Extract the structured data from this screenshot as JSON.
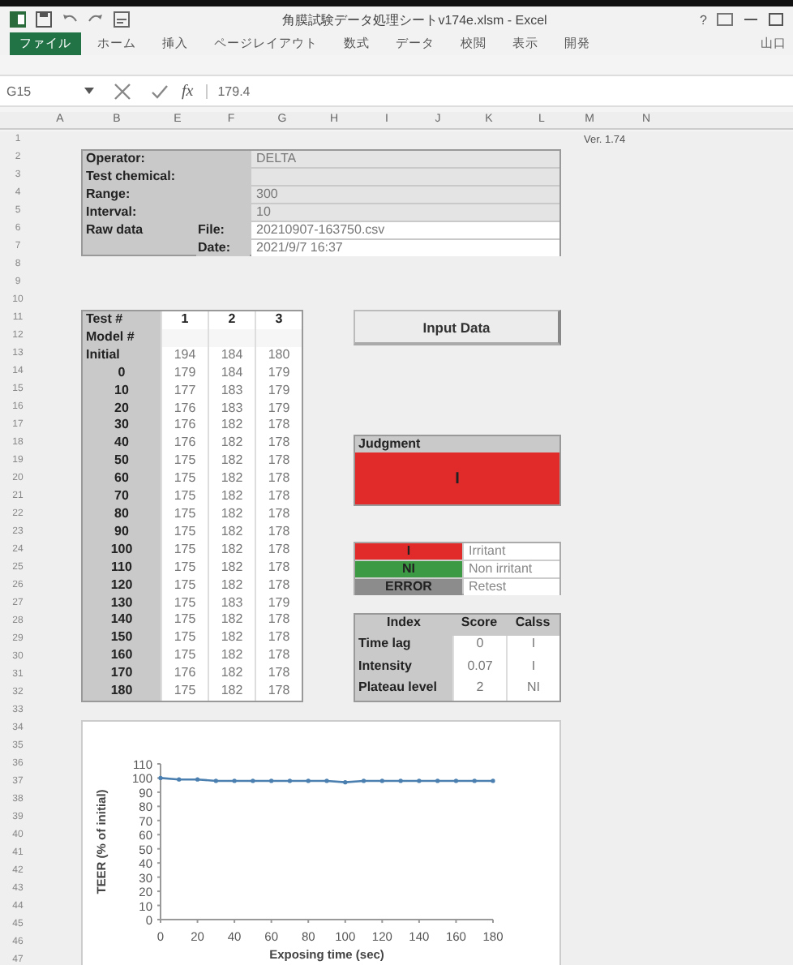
{
  "window": {
    "title": "角膜試験データ処理シートv174e.xlsm - Excel",
    "help": "?"
  },
  "ribbon": {
    "tabs": [
      {
        "label": "ファイル",
        "selected": true
      },
      {
        "label": "ホーム",
        "selected": false
      },
      {
        "label": "挿入",
        "selected": false
      },
      {
        "label": "ページレイアウト",
        "selected": false
      },
      {
        "label": "数式",
        "selected": false
      },
      {
        "label": "データ",
        "selected": false
      },
      {
        "label": "校閲",
        "selected": false
      },
      {
        "label": "表示",
        "selected": false
      },
      {
        "label": "開発",
        "selected": false
      }
    ],
    "user": "山口"
  },
  "formula_bar": {
    "name_box": "G15",
    "fx": "fx",
    "value": "179.4"
  },
  "column_headers": [
    "A",
    "B",
    "E",
    "F",
    "G",
    "H",
    "I",
    "J",
    "K",
    "L",
    "M",
    "N"
  ],
  "row_headers": [
    "1",
    "2",
    "3",
    "4",
    "5",
    "6",
    "7",
    "8",
    "9",
    "10",
    "11",
    "12",
    "13",
    "14",
    "15",
    "16",
    "17",
    "18",
    "19",
    "20",
    "21",
    "22",
    "23",
    "24",
    "25",
    "26",
    "27",
    "28",
    "29",
    "30",
    "31",
    "32",
    "33",
    "34",
    "35",
    "36",
    "37",
    "38",
    "39",
    "40",
    "41",
    "42",
    "43",
    "44",
    "45",
    "46",
    "47"
  ],
  "sheet": {
    "version": "Ver. 1.74",
    "info": [
      {
        "label": "Operator:",
        "value": "DELTA"
      },
      {
        "label": "Test chemical:"
      },
      {
        "label": "Range:",
        "value": "300"
      },
      {
        "label": "Interval:",
        "value": "10"
      }
    ],
    "raw_data": {
      "label": "Raw data",
      "file_label": "File:",
      "file": "20210907-163750.csv",
      "date_label": "Date:",
      "date": "2021/9/7 16:37"
    },
    "test_table": {
      "header": [
        "Test #",
        "1",
        "2",
        "3"
      ],
      "model_label": "Model #",
      "rows": [
        {
          "label": "Initial",
          "values": [
            "194",
            "184",
            "180"
          ]
        },
        {
          "label": "0",
          "values": [
            "179",
            "184",
            "179"
          ]
        },
        {
          "label": "10",
          "values": [
            "177",
            "183",
            "179"
          ]
        },
        {
          "label": "20",
          "values": [
            "176",
            "183",
            "179"
          ]
        },
        {
          "label": "30",
          "values": [
            "176",
            "182",
            "178"
          ]
        },
        {
          "label": "40",
          "values": [
            "176",
            "182",
            "178"
          ]
        },
        {
          "label": "50",
          "values": [
            "175",
            "182",
            "178"
          ]
        },
        {
          "label": "60",
          "values": [
            "175",
            "182",
            "178"
          ]
        },
        {
          "label": "70",
          "values": [
            "175",
            "182",
            "178"
          ]
        },
        {
          "label": "80",
          "values": [
            "175",
            "182",
            "178"
          ]
        },
        {
          "label": "90",
          "values": [
            "175",
            "182",
            "178"
          ]
        },
        {
          "label": "100",
          "values": [
            "175",
            "182",
            "178"
          ]
        },
        {
          "label": "110",
          "values": [
            "175",
            "182",
            "178"
          ]
        },
        {
          "label": "120",
          "values": [
            "175",
            "182",
            "178"
          ]
        },
        {
          "label": "130",
          "values": [
            "175",
            "183",
            "179"
          ]
        },
        {
          "label": "140",
          "values": [
            "175",
            "182",
            "178"
          ]
        },
        {
          "label": "150",
          "values": [
            "175",
            "182",
            "178"
          ]
        },
        {
          "label": "160",
          "values": [
            "175",
            "182",
            "178"
          ]
        },
        {
          "label": "170",
          "values": [
            "176",
            "182",
            "178"
          ]
        },
        {
          "label": "180",
          "values": [
            "175",
            "182",
            "178"
          ]
        }
      ]
    },
    "input_button": "Input Data",
    "judgment": {
      "title": "Judgment",
      "result": "I",
      "color": "#e12b2b"
    },
    "legend": [
      {
        "code": "I",
        "meaning": "Irritant",
        "color": "#e12b2b"
      },
      {
        "code": "NI",
        "meaning": "Non irritant",
        "color": "#3d9a44"
      },
      {
        "code": "ERROR",
        "meaning": "Retest",
        "color": "#8c8c8c"
      }
    ],
    "index_table": {
      "columns": [
        "Index",
        "Score",
        "Calss"
      ],
      "rows": [
        {
          "label": "Time lag",
          "score": "0",
          "class": "I"
        },
        {
          "label": "Intensity",
          "score": "0.07",
          "class": "I"
        },
        {
          "label": "Plateau level",
          "score": "2",
          "class": "NI"
        }
      ]
    },
    "chart": {
      "chart_data": {
        "type": "line",
        "xlabel": "Exposing time (sec)",
        "ylabel": "TEER (% of initial)",
        "x": [
          0,
          10,
          20,
          30,
          40,
          50,
          60,
          70,
          80,
          90,
          100,
          110,
          120,
          130,
          140,
          150,
          160,
          170,
          180
        ],
        "series": [
          {
            "color": "#4a7fb0",
            "values": [
              100,
              99,
              99,
              98,
              98,
              98,
              98,
              98,
              98,
              98,
              97,
              98,
              98,
              98,
              98,
              98,
              98,
              98,
              98
            ]
          }
        ],
        "xlim": [
          0,
          180
        ],
        "ylim": [
          0,
          110
        ],
        "xticks": [
          0,
          20,
          40,
          60,
          80,
          100,
          120,
          140,
          160,
          180
        ],
        "yticks": [
          0,
          10,
          20,
          30,
          40,
          50,
          60,
          70,
          80,
          90,
          100,
          110
        ]
      }
    }
  }
}
